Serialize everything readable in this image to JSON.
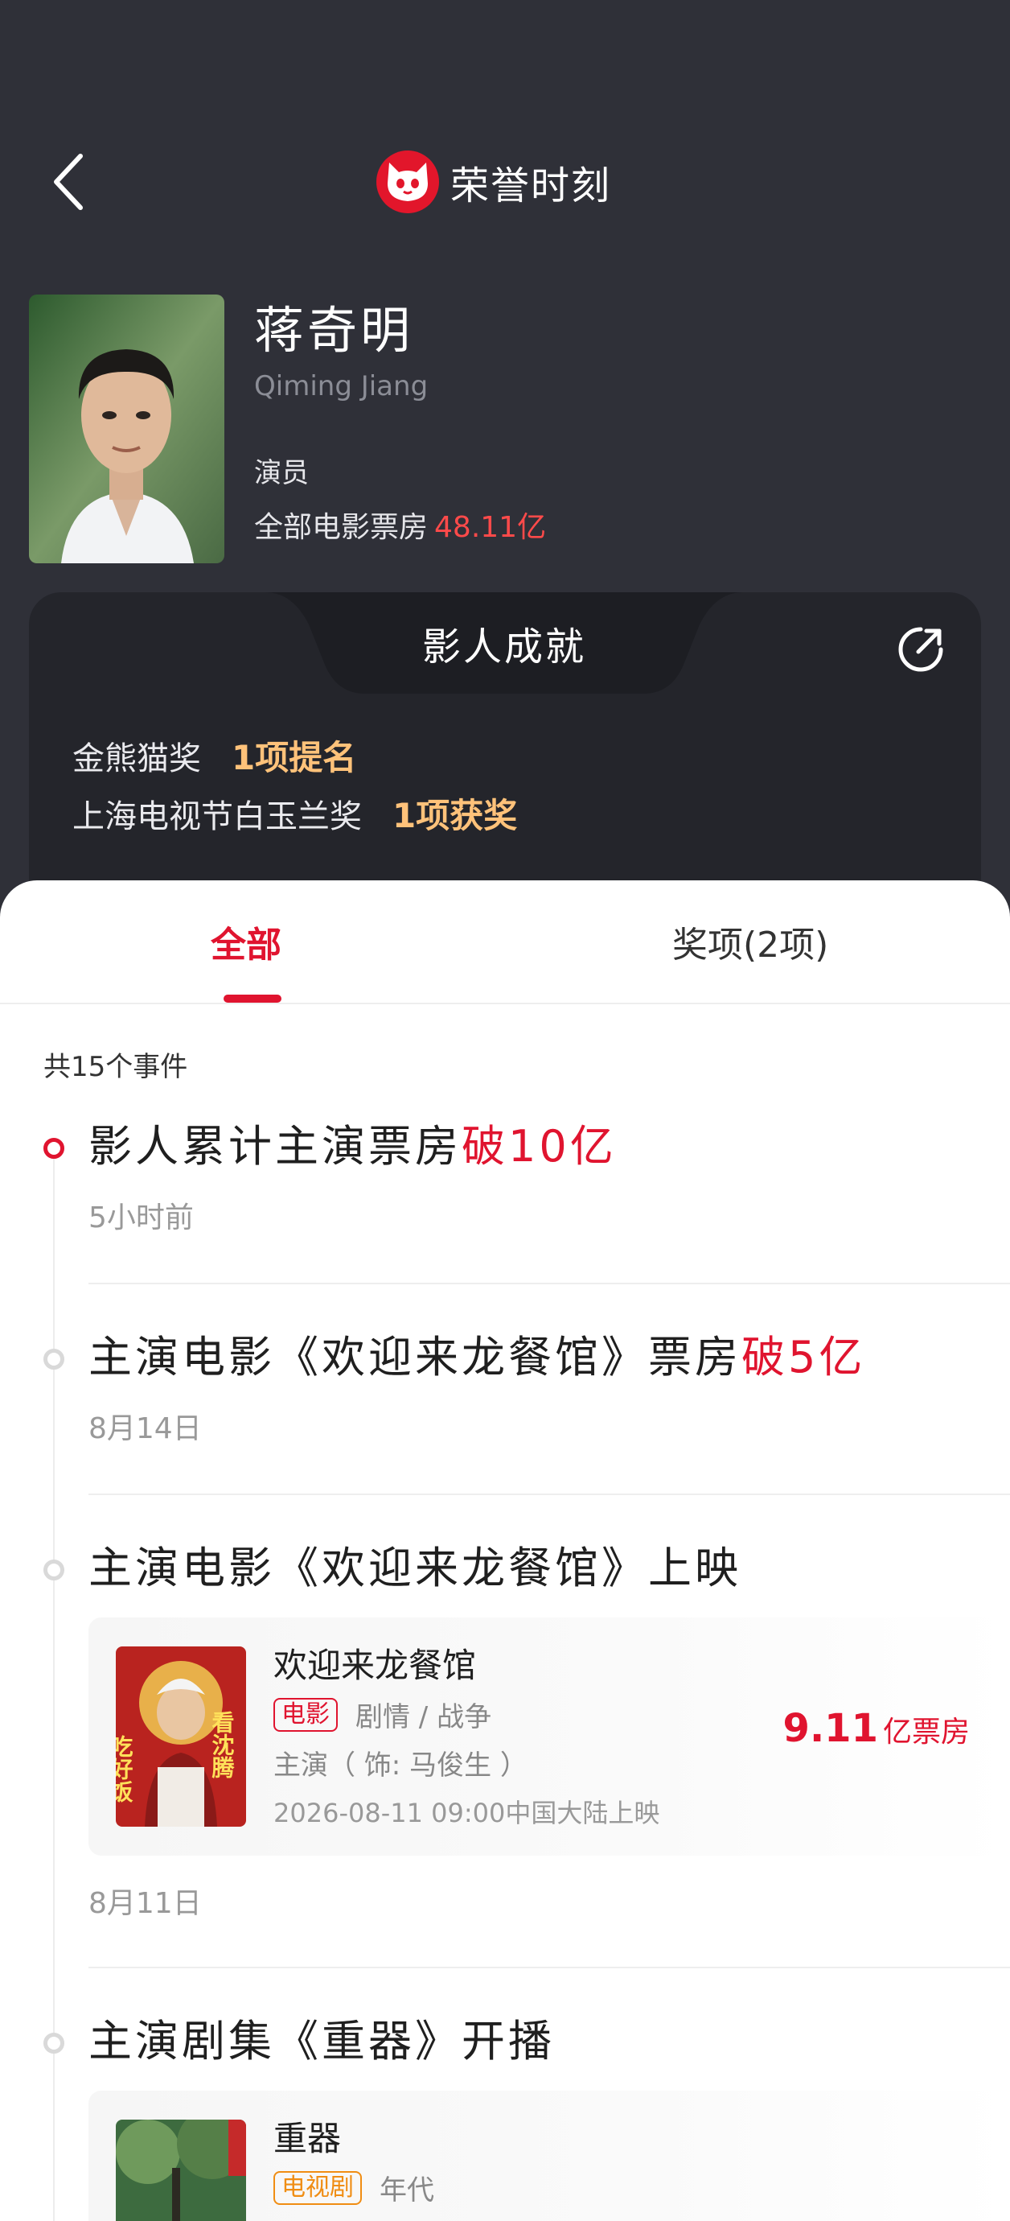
{
  "header": {
    "title": "荣誉时刻"
  },
  "profile": {
    "name": "蒋奇明",
    "name_en": "Qiming Jiang",
    "role": "演员",
    "boxoffice_label": "全部电影票房",
    "boxoffice_value": "48.11亿"
  },
  "achievements": {
    "title": "影人成就",
    "items": [
      {
        "award": "金熊猫奖",
        "count": "1项提名"
      },
      {
        "award": "上海电视节白玉兰奖",
        "count": "1项获奖"
      }
    ]
  },
  "tabs": [
    {
      "label": "全部",
      "active": true
    },
    {
      "label": "奖项(2项)",
      "active": false
    }
  ],
  "events_total": "共15个事件",
  "events": [
    {
      "title": "影人累计主演票房",
      "highlight": "破10亿",
      "date": "5小时前"
    },
    {
      "title": "主演电影《欢迎来龙餐馆》票房",
      "highlight": "破5亿",
      "date": "8月14日"
    },
    {
      "title": "主演电影《欢迎来龙餐馆》上映",
      "highlight": "",
      "date": "8月11日",
      "card": {
        "title": "欢迎来龙餐馆",
        "tag": "电影",
        "genre": "剧情 / 战争",
        "role": "主演（ 饰: 马俊生 ）",
        "release": "2026-08-11 09:00中国大陆上映",
        "boxoffice_num": "9.11",
        "boxoffice_unit": "亿票房",
        "poster_text_left": "吃好饭",
        "poster_text_right": "看沈腾"
      }
    },
    {
      "title": "主演剧集《重器》开播",
      "highlight": "",
      "card": {
        "title": "重器",
        "tag": "电视剧",
        "genre": "年代"
      }
    }
  ],
  "colors": {
    "accent": "#e0142f",
    "gold": "#ffc27a",
    "header_bg": "#2f3038",
    "card_bg": "#24252b"
  }
}
